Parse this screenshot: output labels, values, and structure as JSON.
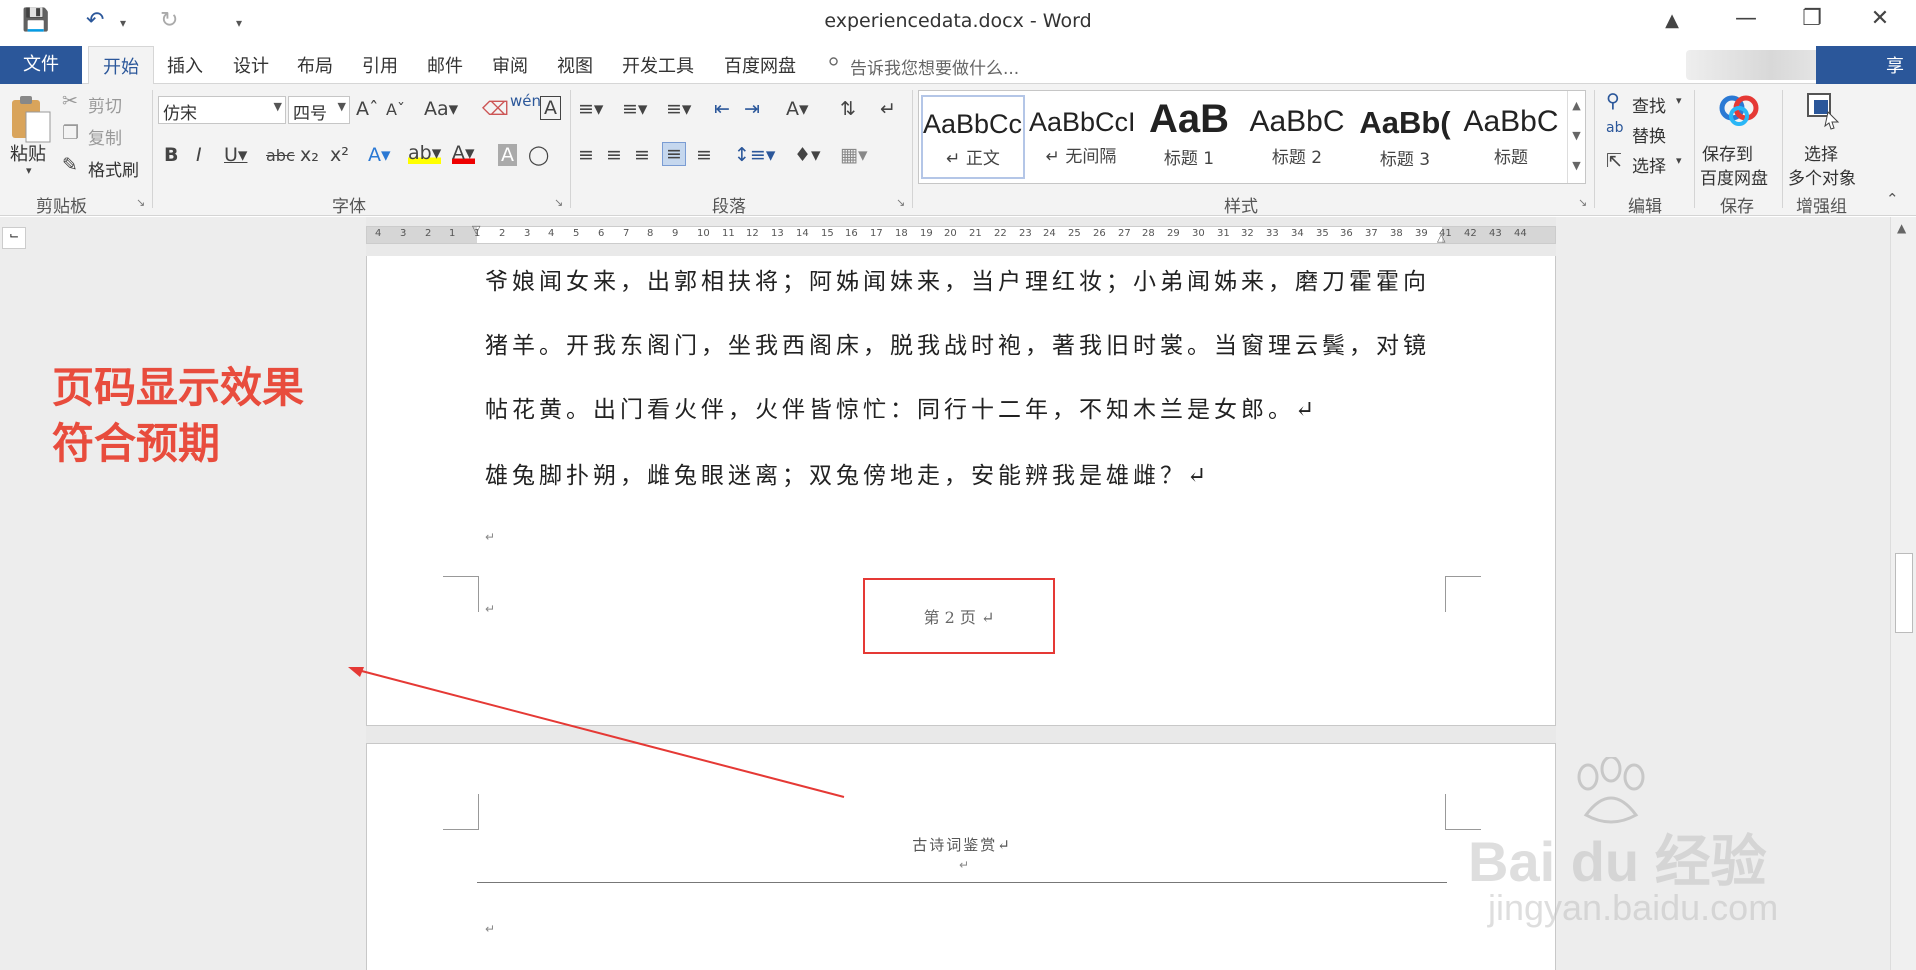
{
  "window": {
    "title": "experiencedata.docx - Word"
  },
  "ribbon_tabs": [
    "文件",
    "开始",
    "插入",
    "设计",
    "布局",
    "引用",
    "邮件",
    "审阅",
    "视图",
    "开发工具",
    "百度网盘"
  ],
  "tell_me": "告诉我您想要做什么...",
  "share_label": "享",
  "clipboard": {
    "paste": "粘贴",
    "cut": "剪切",
    "copy": "复制",
    "format_painter": "格式刷",
    "group_label": "剪贴板"
  },
  "font": {
    "name": "仿宋",
    "size": "四号",
    "group_label": "字体"
  },
  "paragraph": {
    "group_label": "段落"
  },
  "styles": {
    "group_label": "样式",
    "items": [
      {
        "sample": "AaBbCcI",
        "name": "↵ 正文"
      },
      {
        "sample": "AaBbCcI",
        "name": "↵ 无间隔"
      },
      {
        "sample": "AaB",
        "name": "标题 1"
      },
      {
        "sample": "AaBbC",
        "name": "标题 2"
      },
      {
        "sample": "AaBb(",
        "name": "标题 3"
      },
      {
        "sample": "AaBbC",
        "name": "标题"
      }
    ]
  },
  "editing": {
    "find": "查找",
    "replace": "替换",
    "select": "选择",
    "group_label": "编辑"
  },
  "save_group": {
    "button": "保存到\n百度网盘",
    "line1": "保存到",
    "line2": "百度网盘",
    "group_label": "保存"
  },
  "enhance_group": {
    "line1": "选择",
    "line2": "多个对象",
    "group_label": "增强组"
  },
  "ruler_numbers": [
    "4",
    "3",
    "2",
    "1",
    "1",
    "2",
    "3",
    "4",
    "5",
    "6",
    "7",
    "8",
    "9",
    "10",
    "11",
    "12",
    "13",
    "14",
    "15",
    "16",
    "17",
    "18",
    "19",
    "20",
    "21",
    "22",
    "23",
    "24",
    "25",
    "26",
    "27",
    "28",
    "29",
    "30",
    "31",
    "32",
    "33",
    "34",
    "35",
    "36",
    "37",
    "38",
    "39",
    "41",
    "42",
    "43",
    "44"
  ],
  "page1": {
    "lines": [
      "爷娘闻女来，出郭相扶将；阿姊闻妹来，当户理红妆；小弟闻姊来，磨刀霍霍向",
      "猪羊。开我东阁门，坐我西阁床，脱我战时袍，著我旧时裳。当窗理云鬓，对镜",
      "帖花黄。出门看火伴，火伴皆惊忙：同行十二年，不知木兰是女郎。↵",
      "雄兔脚扑朔，雌兔眼迷离；双兔傍地走，安能辨我是雄雌？↵"
    ],
    "footer": "第 2 页 ↵"
  },
  "page2": {
    "header": "古诗词鉴赏↵"
  },
  "annotation": {
    "line1": "页码显示效果",
    "line2": "符合预期"
  },
  "watermark": {
    "brand": "Bai du 经验",
    "url": "jingyan.baidu.com"
  },
  "colors": {
    "accent": "#2b579a",
    "annotation": "#e84c3d",
    "highlight_box": "#e53935"
  }
}
